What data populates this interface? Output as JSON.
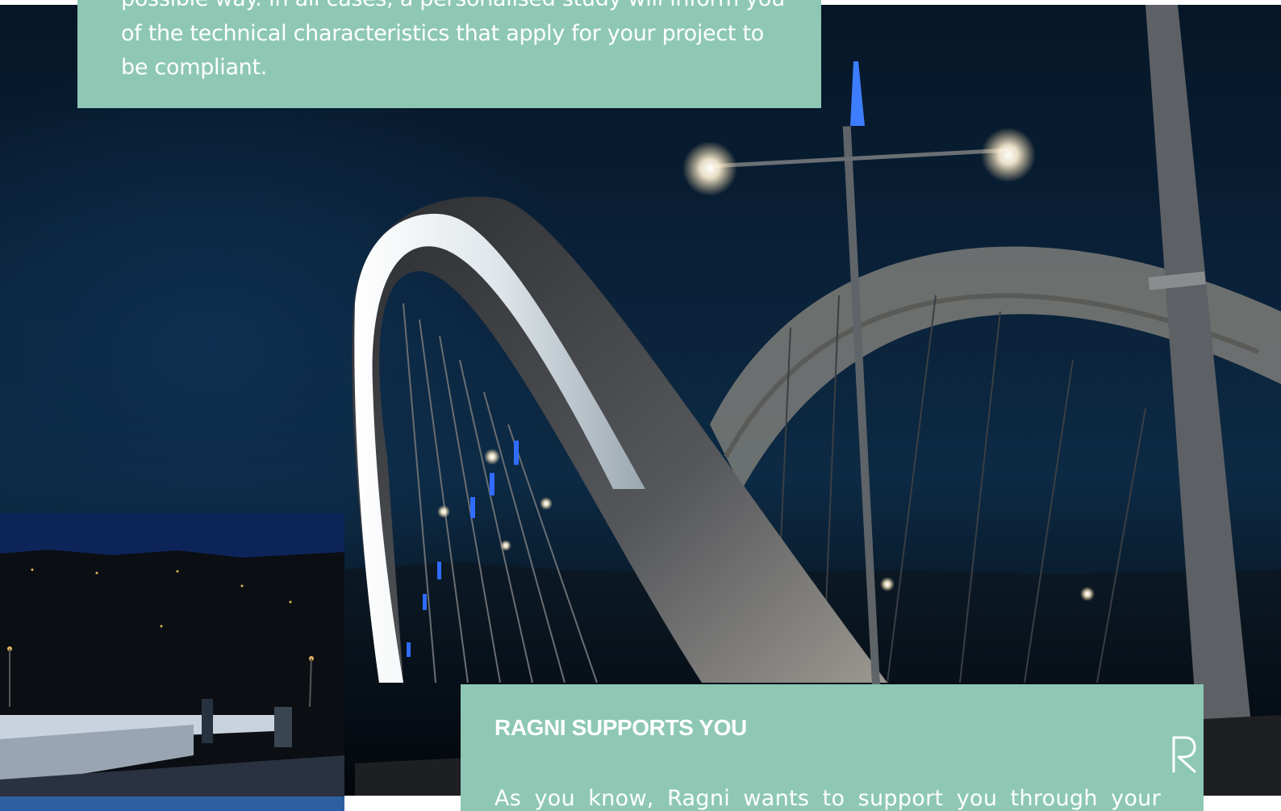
{
  "intro_panel": {
    "text": "possible way. In all cases, a personalised study will inform you of the technical characteristics that apply for your project to be compliant."
  },
  "support_panel": {
    "heading": "RAGNI SUPPORTS YOU",
    "text": "As you know, Ragni wants to support you through your"
  },
  "photo": {
    "icons": [
      "ragni-logo-icon"
    ]
  },
  "colors": {
    "panel": "#8ec8b5",
    "panel_text": "#ffffff",
    "inset_bar": "#2e5fa0",
    "sky": "#0a2138"
  }
}
